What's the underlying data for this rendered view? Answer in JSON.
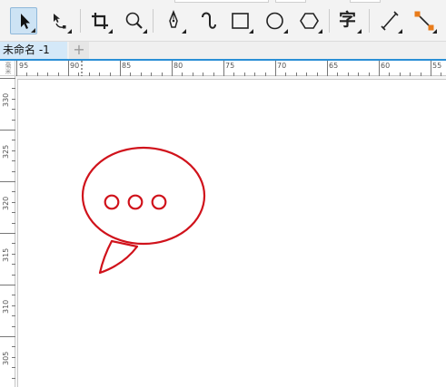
{
  "toolbar": {
    "tools": [
      {
        "name": "pick-tool",
        "icon": "pointer-arrow-icon",
        "active": true
      },
      {
        "name": "shape-tool",
        "icon": "node-edit-icon"
      },
      {
        "name": "crop-tool",
        "icon": "crop-icon"
      },
      {
        "name": "zoom-tool",
        "icon": "magnifier-icon"
      },
      {
        "name": "freehand-tool",
        "icon": "pen-nib-icon"
      },
      {
        "name": "artistic-media-tool",
        "icon": "curve-stroke-icon"
      },
      {
        "name": "rectangle-tool",
        "icon": "rectangle-icon"
      },
      {
        "name": "ellipse-tool",
        "icon": "ellipse-icon"
      },
      {
        "name": "polygon-tool",
        "icon": "polygon-icon"
      },
      {
        "name": "text-tool",
        "icon": "text-char-icon",
        "glyph": "字"
      },
      {
        "name": "parallel-dimension-tool",
        "icon": "dimension-line-icon"
      },
      {
        "name": "connector-tool",
        "icon": "connector-line-icon"
      }
    ]
  },
  "document": {
    "tab_label": "未命名 -1",
    "add_tab_symbol": "+"
  },
  "rulers": {
    "corner_text": "毫米",
    "horizontal_labels": [
      "95",
      "90",
      "85",
      "80",
      "75",
      "70",
      "65",
      "60",
      "55"
    ],
    "vertical_labels": [
      "330",
      "325",
      "320",
      "315",
      "310",
      "305"
    ]
  },
  "drawing": {
    "shape": "speech-bubble",
    "stroke_color": "#d0121b",
    "dots": 3
  }
}
